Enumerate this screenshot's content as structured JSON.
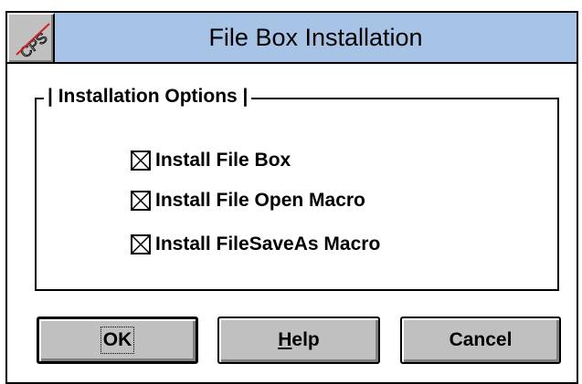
{
  "window": {
    "title": "File Box Installation",
    "system_icon_text": "CPS"
  },
  "group": {
    "label": "| Installation Options |"
  },
  "options": [
    {
      "label": "Install File Box",
      "checked": true
    },
    {
      "label": "Install File Open Macro",
      "checked": true
    },
    {
      "label": "Install FileSaveAs Macro",
      "checked": true
    }
  ],
  "buttons": {
    "ok": "OK",
    "help_accel": "H",
    "help_rest": "elp",
    "cancel": "Cancel"
  },
  "colors": {
    "titlebar": "#a7c4e7",
    "button_face": "#c0c0c0"
  }
}
